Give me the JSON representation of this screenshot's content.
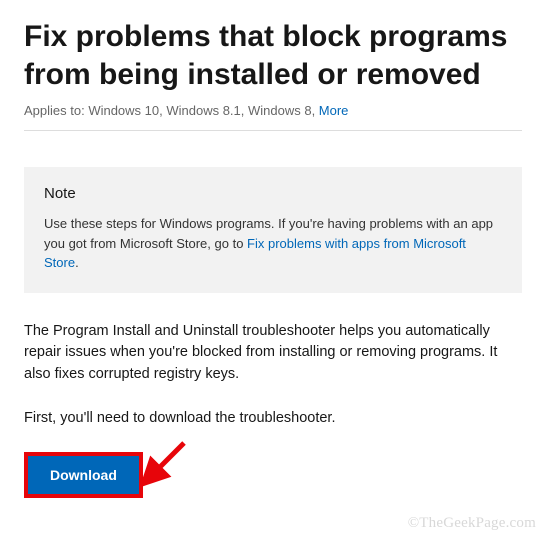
{
  "header": {
    "title": "Fix problems that block programs from being installed or removed",
    "applies_label": "Applies to: Windows 10, Windows 8.1, Windows 8, ",
    "more_label": "More"
  },
  "note": {
    "heading": "Note",
    "text_prefix": "Use these steps for Windows programs. If you're having problems with an app you got from Microsoft Store, go to ",
    "link_text": "Fix problems with apps from Microsoft Store",
    "text_suffix": "."
  },
  "body": {
    "paragraph1": "The Program Install and Uninstall troubleshooter helps you automatically repair issues when you're blocked from installing or removing programs. It also fixes corrupted registry keys.",
    "paragraph2": "First, you'll need to download the troubleshooter."
  },
  "actions": {
    "download_label": "Download"
  },
  "watermark": "©TheGeekPage.com"
}
